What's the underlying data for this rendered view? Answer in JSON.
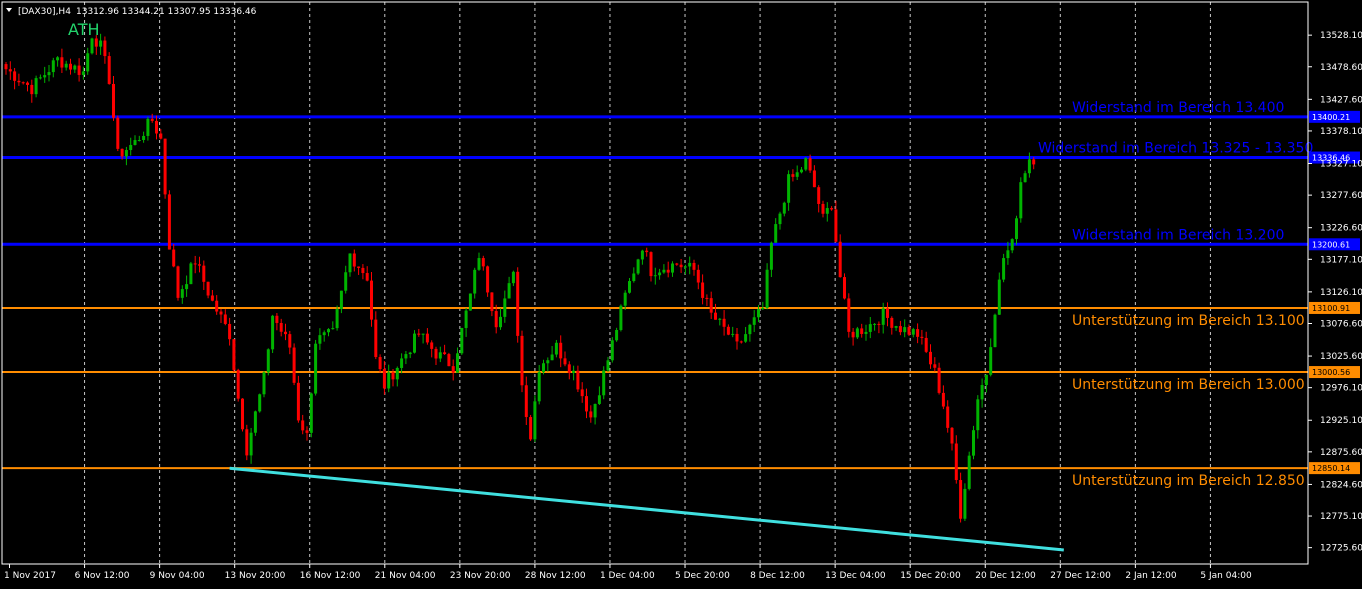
{
  "header": {
    "dropdown_icon": "triangle-down-icon",
    "symbol": "[DAX30],H4",
    "ohlc": "13312.96 13344.21 13307.95 13336.46"
  },
  "annotation": {
    "text": "ATH",
    "color": "#22d36b"
  },
  "colors": {
    "background": "#000000",
    "frame": "#ffffff",
    "grid": "#c8c8c8",
    "bull": "#00b400",
    "bear": "#ff0000",
    "resistance": "#0000ff",
    "support": "#ff8c00",
    "trendline": "#40e0e0",
    "badge_text": "#000000"
  },
  "chart_data": {
    "type": "candlestick",
    "title": "[DAX30],H4",
    "ylim": [
      12700,
      13580
    ],
    "y_ticks": [
      "13528.10",
      "13478.60",
      "13427.60",
      "13378.10",
      "13327.10",
      "13277.60",
      "13226.60",
      "13177.10",
      "13126.10",
      "13076.60",
      "13025.60",
      "12976.10",
      "12925.10",
      "12875.60",
      "12824.60",
      "12775.10",
      "12725.60"
    ],
    "x_ticks": [
      "1 Nov 2017",
      "6 Nov 12:00",
      "9 Nov 04:00",
      "13 Nov 20:00",
      "16 Nov 12:00",
      "21 Nov 04:00",
      "23 Nov 20:00",
      "28 Nov 12:00",
      "1 Dec 04:00",
      "5 Dec 20:00",
      "8 Dec 12:00",
      "13 Dec 04:00",
      "15 Dec 20:00",
      "20 Dec 12:00",
      "27 Dec 12:00",
      "2 Jan 12:00",
      "5 Jan 04:00"
    ],
    "grid": true,
    "levels": [
      {
        "label": "Widerstand im Bereich 13.400",
        "value": 13400.21,
        "badge": "13400.21",
        "kind": "resistance"
      },
      {
        "label": "Widerstand im Bereich 13.325 - 13.350",
        "value": 13336.46,
        "badge": "13336.46",
        "kind": "resistance"
      },
      {
        "label": "Widerstand im Bereich 13.200",
        "value": 13200.61,
        "badge": "13200.61",
        "kind": "resistance"
      },
      {
        "label": "Unterstützung im Bereich 13.100",
        "value": 13100.91,
        "badge": "13100.91",
        "kind": "support"
      },
      {
        "label": "Unterstützung im Bereich 13.000",
        "value": 13000.56,
        "badge": "13000.56",
        "kind": "support"
      },
      {
        "label": "Unterstützung im Bereich 12.850",
        "value": 12850.14,
        "badge": "12850.14",
        "kind": "support"
      }
    ],
    "trendline": {
      "from_index": 52,
      "from_value": 12850,
      "to_index": 246,
      "to_value": 12722
    },
    "anchors": [
      [
        0,
        13475
      ],
      [
        6,
        13445
      ],
      [
        12,
        13490
      ],
      [
        18,
        13470
      ],
      [
        20,
        13530
      ],
      [
        22,
        13510
      ],
      [
        24,
        13460
      ],
      [
        26,
        13340
      ],
      [
        30,
        13360
      ],
      [
        34,
        13395
      ],
      [
        36,
        13365
      ],
      [
        38,
        13200
      ],
      [
        40,
        13120
      ],
      [
        44,
        13175
      ],
      [
        48,
        13110
      ],
      [
        52,
        13060
      ],
      [
        54,
        12960
      ],
      [
        56,
        12880
      ],
      [
        60,
        12990
      ],
      [
        62,
        13090
      ],
      [
        66,
        13040
      ],
      [
        68,
        12930
      ],
      [
        70,
        12900
      ],
      [
        72,
        13050
      ],
      [
        76,
        13060
      ],
      [
        80,
        13185
      ],
      [
        84,
        13150
      ],
      [
        86,
        13020
      ],
      [
        88,
        12980
      ],
      [
        92,
        13020
      ],
      [
        96,
        13060
      ],
      [
        100,
        13030
      ],
      [
        104,
        13010
      ],
      [
        108,
        13120
      ],
      [
        110,
        13185
      ],
      [
        114,
        13080
      ],
      [
        118,
        13150
      ],
      [
        120,
        12980
      ],
      [
        122,
        12900
      ],
      [
        124,
        13010
      ],
      [
        128,
        13040
      ],
      [
        132,
        13000
      ],
      [
        136,
        12930
      ],
      [
        140,
        13020
      ],
      [
        144,
        13120
      ],
      [
        148,
        13200
      ],
      [
        150,
        13160
      ],
      [
        156,
        13170
      ],
      [
        160,
        13160
      ],
      [
        164,
        13090
      ],
      [
        168,
        13060
      ],
      [
        170,
        13040
      ],
      [
        176,
        13100
      ],
      [
        178,
        13200
      ],
      [
        182,
        13300
      ],
      [
        184,
        13310
      ],
      [
        186,
        13330
      ],
      [
        188,
        13290
      ],
      [
        190,
        13240
      ],
      [
        192,
        13265
      ],
      [
        194,
        13150
      ],
      [
        196,
        13060
      ],
      [
        200,
        13070
      ],
      [
        204,
        13090
      ],
      [
        208,
        13070
      ],
      [
        212,
        13060
      ],
      [
        216,
        13000
      ],
      [
        218,
        12950
      ],
      [
        220,
        12880
      ],
      [
        222,
        12780
      ],
      [
        224,
        12870
      ],
      [
        226,
        12960
      ],
      [
        228,
        13000
      ],
      [
        230,
        13100
      ],
      [
        232,
        13180
      ],
      [
        234,
        13200
      ],
      [
        236,
        13300
      ],
      [
        238,
        13336
      ]
    ]
  }
}
